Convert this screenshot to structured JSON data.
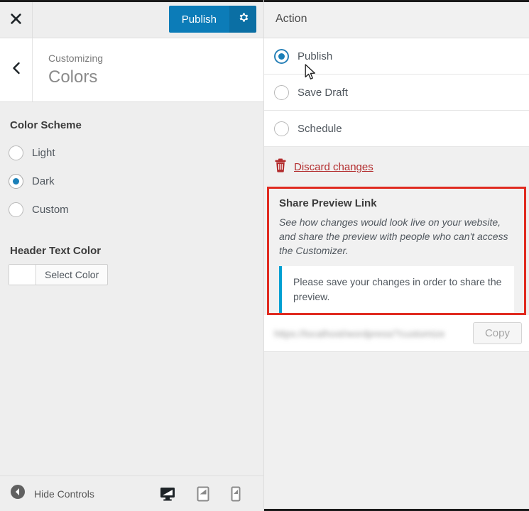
{
  "left": {
    "close_icon": "close-icon",
    "publish_label": "Publish",
    "gear_icon": "gear-icon",
    "back_icon": "chevron-left-icon",
    "breadcrumb_small": "Customizing",
    "breadcrumb_title": "Colors",
    "color_scheme": {
      "title": "Color Scheme",
      "options": [
        {
          "label": "Light",
          "selected": false
        },
        {
          "label": "Dark",
          "selected": true
        },
        {
          "label": "Custom",
          "selected": false
        }
      ]
    },
    "header_text_color": {
      "title": "Header Text Color",
      "button_label": "Select Color",
      "swatch_color": "#ffffff"
    },
    "footer": {
      "hide_controls_label": "Hide Controls",
      "collapse_icon": "collapse-arrow-icon",
      "devices": [
        {
          "name": "desktop-preview",
          "active": true
        },
        {
          "name": "tablet-preview",
          "active": false
        },
        {
          "name": "mobile-preview",
          "active": false
        }
      ]
    }
  },
  "right": {
    "header_title": "Action",
    "actions": [
      {
        "label": "Publish",
        "selected": true
      },
      {
        "label": "Save Draft",
        "selected": false
      },
      {
        "label": "Schedule",
        "selected": false
      }
    ],
    "discard": {
      "label": "Discard changes",
      "icon": "trash-icon",
      "color": "#b32d2e"
    },
    "share": {
      "title": "Share Preview Link",
      "description": "See how changes would look live on your website, and share the preview with people who can't access the Customizer.",
      "notice": "Please save your changes in order to share the preview.",
      "highlight_color": "#e02b20",
      "notice_accent_color": "#00a0d2",
      "url_value": "https://localhost/wordpress/?customize",
      "copy_label": "Copy"
    }
  },
  "colors": {
    "publish_blue": "#0c7cb8",
    "panel_grey": "#eeeeee",
    "accent_red": "#b32d2e"
  }
}
